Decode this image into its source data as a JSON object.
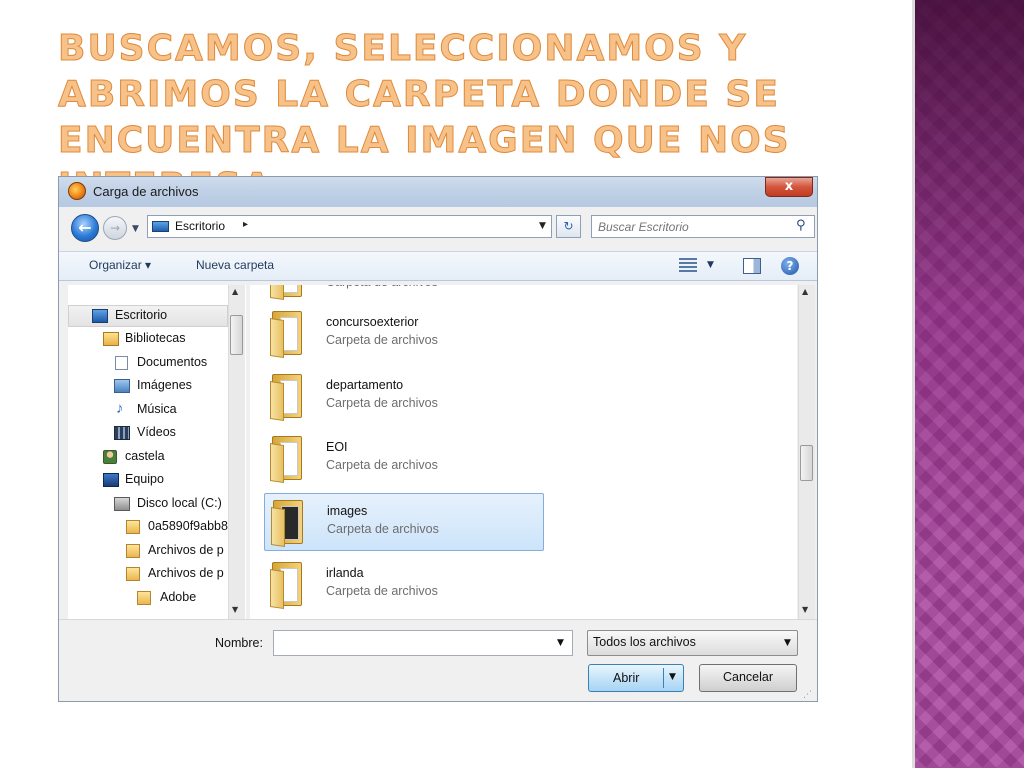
{
  "slide": {
    "title": "Buscamos, seleccionamos y abrimos la carpeta donde se encuentra la imagen que nos interesa"
  },
  "dialog": {
    "title": "Carga de archivos",
    "close_symbol": "x",
    "address": {
      "location": "Escritorio",
      "chevron": "▸"
    },
    "search": {
      "placeholder": "Buscar Escritorio"
    },
    "toolbar": {
      "organize": "Organizar ▾",
      "new_folder": "Nueva carpeta"
    },
    "nav_items": [
      {
        "label": "Escritorio",
        "icon": "desktop-icon"
      },
      {
        "label": "Bibliotecas",
        "icon": "libraries-icon"
      },
      {
        "label": "Documentos",
        "icon": "documents-icon"
      },
      {
        "label": "Imágenes",
        "icon": "pictures-icon"
      },
      {
        "label": "Música",
        "icon": "music-icon"
      },
      {
        "label": "Vídeos",
        "icon": "videos-icon"
      },
      {
        "label": "castela",
        "icon": "user-icon"
      },
      {
        "label": "Equipo",
        "icon": "computer-icon"
      },
      {
        "label": "Disco local (C:)",
        "icon": "disk-icon"
      },
      {
        "label": "0a5890f9abb8",
        "icon": "folder-icon"
      },
      {
        "label": "Archivos de p",
        "icon": "folder-icon"
      },
      {
        "label": "Archivos de p",
        "icon": "folder-icon"
      },
      {
        "label": "Adobe",
        "icon": "folder-icon"
      }
    ],
    "files": [
      {
        "name": "",
        "type": "Carpeta de archivos"
      },
      {
        "name": "concursoexterior",
        "type": "Carpeta de archivos"
      },
      {
        "name": "departamento",
        "type": "Carpeta de archivos"
      },
      {
        "name": "EOI",
        "type": "Carpeta de archivos"
      },
      {
        "name": "images",
        "type": "Carpeta de archivos",
        "selected": true
      },
      {
        "name": "irlanda",
        "type": "Carpeta de archivos"
      }
    ],
    "file_name_label": "Nombre:",
    "file_name_value": "",
    "filter": "Todos los archivos",
    "open_button": "Abrir",
    "cancel_button": "Cancelar",
    "colors": {
      "selection": "#cde4fa",
      "title_text": "#f6c28a",
      "band": "#a8449e"
    }
  }
}
